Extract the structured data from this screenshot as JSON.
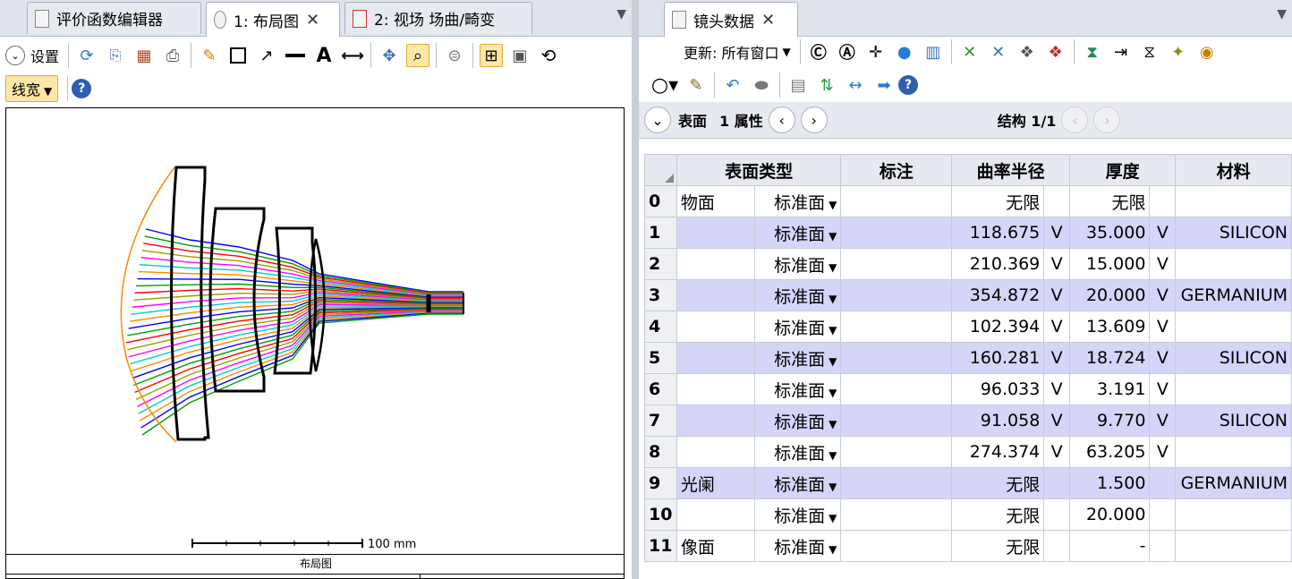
{
  "tabs_left": [
    {
      "label": "评价函数编辑器"
    },
    {
      "label": "1: 布局图"
    },
    {
      "label": "2: 视场 场曲/畸变"
    }
  ],
  "tabs_right": [
    {
      "label": "镜头数据"
    }
  ],
  "left_toolbar": {
    "settings_label": "设置",
    "linewidth_label": "线宽"
  },
  "layout": {
    "scale_label": "100 mm",
    "caption": "布局图"
  },
  "right_toolbar": {
    "update_label": "更新: 所有窗口"
  },
  "lensbar": {
    "surface_label": "表面",
    "property_label": "1 属性",
    "structure_label": "结构 1/1"
  },
  "lens_table": {
    "headers": [
      "表面类型",
      "标注",
      "曲率半径",
      "厚度",
      "材料"
    ],
    "rows": [
      {
        "idx": "0",
        "name": "物面",
        "type": "标准面",
        "comment": "",
        "radius": "无限",
        "rv": "",
        "thickness": "无限",
        "tv": "",
        "material": ""
      },
      {
        "idx": "1",
        "name": "",
        "type": "标准面",
        "comment": "",
        "radius": "118.675",
        "rv": "V",
        "thickness": "35.000",
        "tv": "V",
        "material": "SILICON"
      },
      {
        "idx": "2",
        "name": "",
        "type": "标准面",
        "comment": "",
        "radius": "210.369",
        "rv": "V",
        "thickness": "15.000",
        "tv": "V",
        "material": ""
      },
      {
        "idx": "3",
        "name": "",
        "type": "标准面",
        "comment": "",
        "radius": "354.872",
        "rv": "V",
        "thickness": "20.000",
        "tv": "V",
        "material": "GERMANIUM"
      },
      {
        "idx": "4",
        "name": "",
        "type": "标准面",
        "comment": "",
        "radius": "102.394",
        "rv": "V",
        "thickness": "13.609",
        "tv": "V",
        "material": ""
      },
      {
        "idx": "5",
        "name": "",
        "type": "标准面",
        "comment": "",
        "radius": "160.281",
        "rv": "V",
        "thickness": "18.724",
        "tv": "V",
        "material": "SILICON"
      },
      {
        "idx": "6",
        "name": "",
        "type": "标准面",
        "comment": "",
        "radius": "96.033",
        "rv": "V",
        "thickness": "3.191",
        "tv": "V",
        "material": ""
      },
      {
        "idx": "7",
        "name": "",
        "type": "标准面",
        "comment": "",
        "radius": "91.058",
        "rv": "V",
        "thickness": "9.770",
        "tv": "V",
        "material": "SILICON"
      },
      {
        "idx": "8",
        "name": "",
        "type": "标准面",
        "comment": "",
        "radius": "274.374",
        "rv": "V",
        "thickness": "63.205",
        "tv": "V",
        "material": ""
      },
      {
        "idx": "9",
        "name": "光阑",
        "type": "标准面",
        "comment": "",
        "radius": "无限",
        "rv": "",
        "thickness": "1.500",
        "tv": "",
        "material": "GERMANIUM"
      },
      {
        "idx": "10",
        "name": "",
        "type": "标准面",
        "comment": "",
        "radius": "无限",
        "rv": "",
        "thickness": "20.000",
        "tv": "",
        "material": ""
      },
      {
        "idx": "11",
        "name": "像面",
        "type": "标准面",
        "comment": "",
        "radius": "无限",
        "rv": "",
        "thickness": "-",
        "tv": "",
        "material": ""
      }
    ]
  },
  "colors": {
    "ray_colors": [
      "#0000ff",
      "#00a000",
      "#ff0000",
      "#9aa000",
      "#ff00ff",
      "#00cccc",
      "#ff8800"
    ],
    "field_arc": "#ff8800",
    "highlight_row": "#d4d5f8"
  }
}
